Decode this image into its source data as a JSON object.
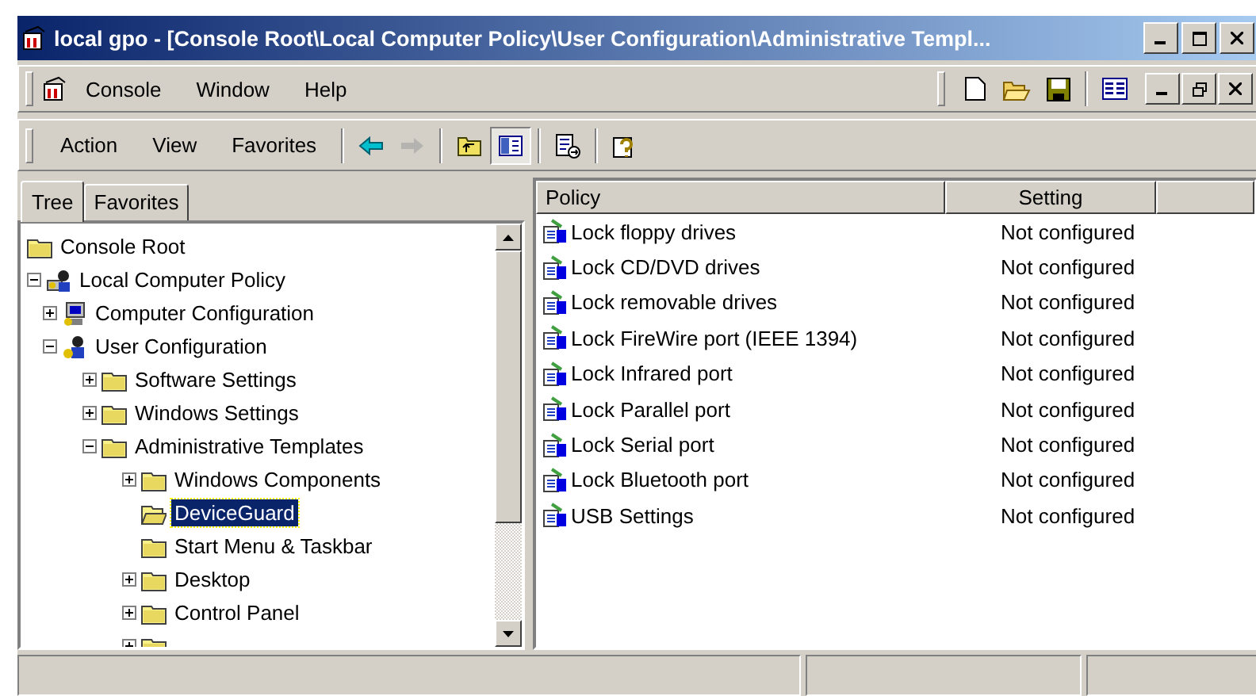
{
  "window": {
    "title": "local gpo - [Console Root\\Local Computer Policy\\User Configuration\\Administrative Templ..."
  },
  "menu_bar": {
    "items": [
      {
        "label": "Console"
      },
      {
        "label": "Window"
      },
      {
        "label": "Help"
      }
    ]
  },
  "toolbar": {
    "menus": [
      {
        "label": "Action"
      },
      {
        "label": "View"
      },
      {
        "label": "Favorites"
      }
    ],
    "buttons": [
      {
        "kind": "back",
        "disabled": false,
        "pressed": false
      },
      {
        "kind": "forward",
        "disabled": true,
        "pressed": false
      },
      {
        "kind": "sep"
      },
      {
        "kind": "up",
        "disabled": false,
        "pressed": false
      },
      {
        "kind": "tree",
        "disabled": false,
        "pressed": true
      },
      {
        "kind": "sep"
      },
      {
        "kind": "export",
        "disabled": false,
        "pressed": false
      },
      {
        "kind": "sep"
      },
      {
        "kind": "help",
        "disabled": false,
        "pressed": false
      }
    ]
  },
  "tabs": [
    {
      "label": "Tree",
      "selected": true
    },
    {
      "label": "Favorites",
      "selected": false
    }
  ],
  "tree": {
    "items": [
      {
        "label": "Console Root",
        "kind": "folder",
        "selected": false
      },
      {
        "label": "Local Computer Policy",
        "kind": "policy",
        "selected": false,
        "expanded": true,
        "children": [
          {
            "label": "Computer Configuration",
            "kind": "computer",
            "selected": false,
            "expanded": false
          },
          {
            "label": "User Configuration",
            "kind": "user",
            "selected": false,
            "expanded": true,
            "children": [
              {
                "label": "Software Settings",
                "kind": "folder",
                "selected": false,
                "expanded": false
              },
              {
                "label": "Windows Settings",
                "kind": "folder",
                "selected": false,
                "expanded": false
              },
              {
                "label": "Administrative Templates",
                "kind": "folder",
                "selected": false,
                "expanded": true,
                "children": [
                  {
                    "label": "Windows Components",
                    "kind": "folder",
                    "selected": false,
                    "expanded": false
                  },
                  {
                    "label": "DeviceGuard",
                    "kind": "folder",
                    "selected": true
                  },
                  {
                    "label": "Start Menu & Taskbar",
                    "kind": "folder",
                    "selected": false
                  },
                  {
                    "label": "Desktop",
                    "kind": "folder",
                    "selected": false,
                    "expanded": false
                  },
                  {
                    "label": "Control Panel",
                    "kind": "folder",
                    "selected": false,
                    "expanded": false
                  },
                  {
                    "kind": "folder",
                    "selected": false,
                    "expanded": false
                  }
                ]
              }
            ]
          }
        ]
      }
    ]
  },
  "list": {
    "columns": [
      "Policy",
      "Setting"
    ],
    "rows": [
      {
        "name": "Lock floppy drives",
        "setting": "Not configured"
      },
      {
        "name": "Lock CD/DVD drives",
        "setting": "Not configured"
      },
      {
        "name": "Lock removable drives",
        "setting": "Not configured"
      },
      {
        "name": "Lock FireWire port (IEEE 1394)",
        "setting": "Not configured"
      },
      {
        "name": "Lock Infrared port",
        "setting": "Not configured"
      },
      {
        "name": "Lock Parallel port",
        "setting": "Not configured"
      },
      {
        "name": "Lock Serial port",
        "setting": "Not configured"
      },
      {
        "name": "Lock Bluetooth port",
        "setting": "Not configured"
      },
      {
        "name": "USB Settings",
        "setting": "Not configured"
      }
    ]
  }
}
